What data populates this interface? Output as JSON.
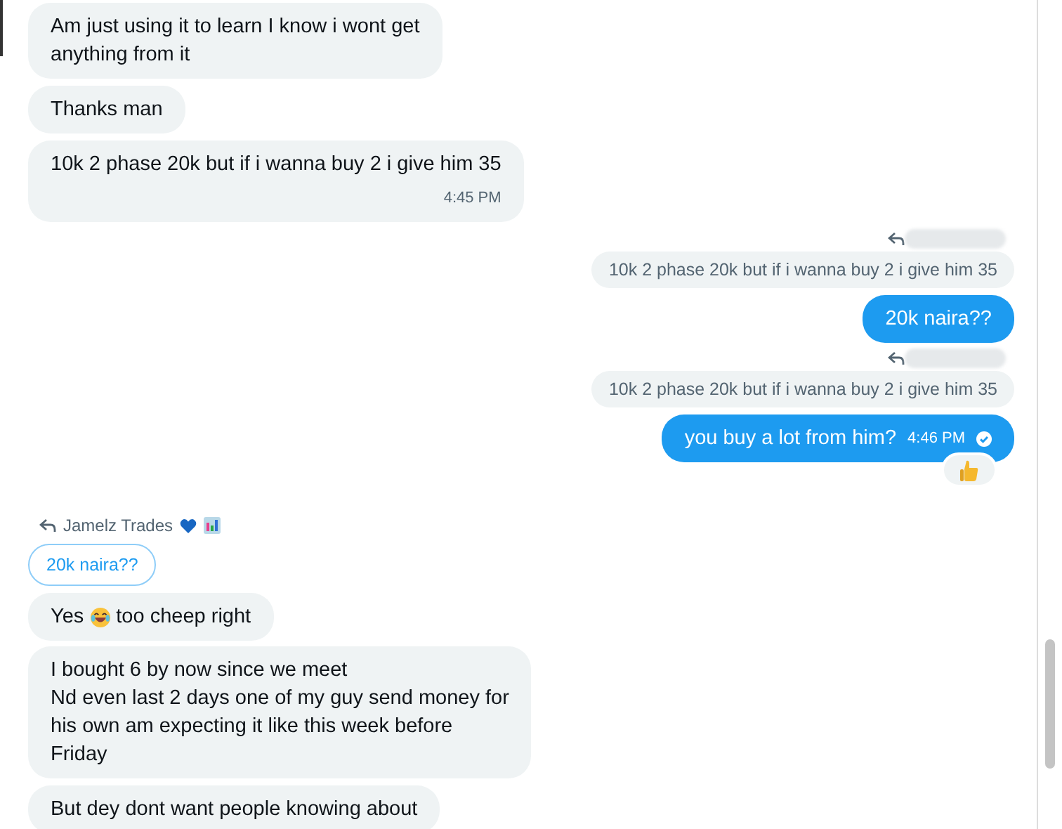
{
  "messages": [
    {
      "kind": "received",
      "text": "Am just using it to learn I know i wont get\nanything from it"
    },
    {
      "kind": "received",
      "text": "Thanks man"
    },
    {
      "kind": "received",
      "text": "10k 2 phase 20k but if i wanna buy 2 i give him 35",
      "time": "4:45 PM"
    },
    {
      "kind": "sent_quote",
      "text": "10k 2 phase 20k but if i wanna buy 2 i give him 35"
    },
    {
      "kind": "sent",
      "text": "20k naira??"
    },
    {
      "kind": "sent_quote",
      "text": "10k 2 phase 20k but if i wanna buy 2 i give him 35"
    },
    {
      "kind": "sent",
      "text": "you buy a lot from him?",
      "time": "4:46 PM",
      "seen": true,
      "thumbs_up_reaction": true
    },
    {
      "kind": "received_quote",
      "author": "Jamelz Trades",
      "text": "20k naira??"
    },
    {
      "kind": "received_emoji",
      "text_before": "Yes",
      "text_after": "too cheep right"
    },
    {
      "kind": "received",
      "text": "I bought 6 by now since we meet\nNd even last 2 days one of my guy send money for\nhis own am expecting it like this week before\nFriday"
    },
    {
      "kind": "received",
      "text": "But dey dont want people knowing about"
    }
  ]
}
